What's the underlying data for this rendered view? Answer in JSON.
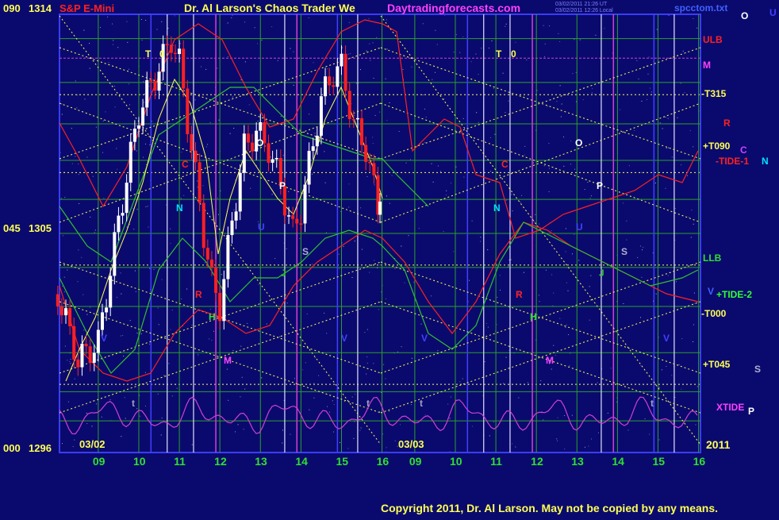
{
  "header": {
    "instrument": "S&P E-Mini",
    "title": "Dr. Al Larson's Chaos Trader We",
    "website": "Daytradingforecasts.com",
    "timestamps": [
      "03/02/2011 21:26 UT",
      "03/02/2011 12:26 Local"
    ],
    "file": "spcctom.txt"
  },
  "y_labels": [
    {
      "angle": "090",
      "price": "1314"
    },
    {
      "angle": "045",
      "price": "1305"
    },
    {
      "angle": "000",
      "price": "1296"
    }
  ],
  "dates": [
    "03/02",
    "03/03"
  ],
  "year": "2011",
  "x_tick_labels": [
    "09",
    "10",
    "11",
    "12",
    "13",
    "14",
    "15",
    "16",
    "09",
    "10",
    "11",
    "12",
    "13",
    "14",
    "15",
    "16"
  ],
  "right_labels": {
    "ulb": "ULB",
    "m": "M",
    "t315": "-T315",
    "r": "R",
    "t090": "+T090",
    "c": "C",
    "tide1": "-TIDE-1",
    "n": "N",
    "llb": "LLB",
    "v": "V",
    "tide2": "+TIDE-2",
    "t000": "-T000",
    "t045": "+T045",
    "s": "S",
    "xtide": "XTIDE",
    "p": "P",
    "o": "O",
    "u": "U"
  },
  "markers": {
    "t": "T",
    "zero": "0",
    "o": "O",
    "p": "P",
    "c": "C",
    "n": "N",
    "u": "U",
    "s": "S",
    "j": "J",
    "h": "H",
    "r": "R",
    "m": "M",
    "v": "V",
    "t_small": "t"
  },
  "copyright": "Copyright 2011, Dr. Al Larson. May not be copied by any means.",
  "colors": {
    "background": "#0a0a6e",
    "border": "#3b3bff",
    "grid": "#2aa02a",
    "yellow": "#ffff55",
    "red": "#ff2020",
    "green": "#30c030",
    "magenta": "#d040d0",
    "white": "#ffffff",
    "cyan": "#00e0ff",
    "blue": "#4040ff",
    "purple": "#b040ff"
  },
  "chart_data": {
    "type": "candlestick",
    "title": "S&P E-Mini",
    "ylim": [
      1296,
      1314
    ],
    "y_ticks": [
      1296,
      1305,
      1314
    ],
    "x_ticks": [
      "03/02 09",
      "10",
      "11",
      "12",
      "13",
      "14",
      "15",
      "16",
      "03/03 09",
      "10",
      "11",
      "12",
      "13",
      "14",
      "15",
      "16"
    ],
    "series": [
      {
        "name": "price",
        "points": [
          [
            8.0,
            1302.5
          ],
          [
            8.5,
            1299.8
          ],
          [
            9.0,
            1300.5
          ],
          [
            9.5,
            1305.5
          ],
          [
            10.0,
            1310.0
          ],
          [
            10.5,
            1311.8
          ],
          [
            10.8,
            1313.0
          ],
          [
            11.0,
            1312.0
          ],
          [
            11.3,
            1308.5
          ],
          [
            11.6,
            1305.0
          ],
          [
            11.8,
            1303.0
          ],
          [
            12.0,
            1302.0
          ],
          [
            12.3,
            1305.5
          ],
          [
            12.6,
            1308.5
          ],
          [
            12.9,
            1309.2
          ],
          [
            13.2,
            1308.5
          ],
          [
            13.5,
            1307.0
          ],
          [
            13.8,
            1305.0
          ],
          [
            14.0,
            1306.0
          ],
          [
            14.2,
            1307.8
          ],
          [
            14.5,
            1310.5
          ],
          [
            14.8,
            1311.6
          ],
          [
            15.0,
            1311.8
          ],
          [
            15.3,
            1309.5
          ],
          [
            15.6,
            1308.5
          ],
          [
            15.9,
            1306.0
          ],
          [
            16.0,
            1305.5
          ]
        ]
      },
      {
        "name": "ULB",
        "color": "red"
      },
      {
        "name": "LLB",
        "color": "green"
      },
      {
        "name": "XTIDE",
        "color": "magenta"
      }
    ]
  }
}
